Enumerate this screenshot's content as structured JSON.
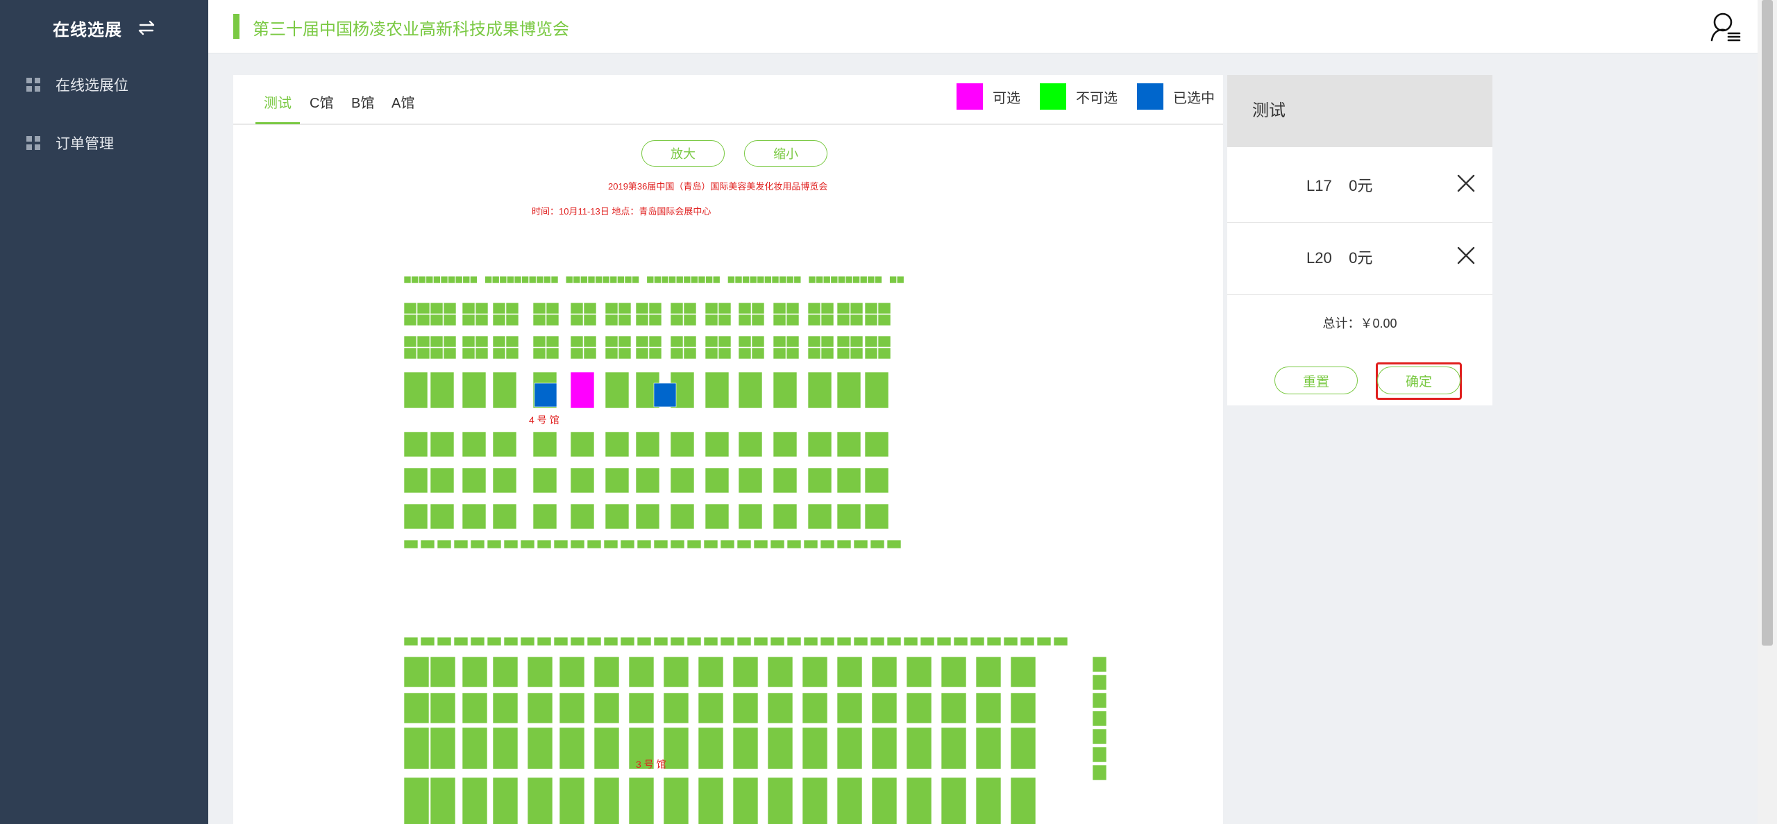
{
  "sidebar": {
    "title": "在线选展",
    "items": [
      {
        "label": "在线选展位"
      },
      {
        "label": "订单管理"
      }
    ]
  },
  "header": {
    "title": "第三十届中国杨凌农业高新科技成果博览会"
  },
  "tabs": [
    "测试",
    "C馆",
    "B馆",
    "A馆"
  ],
  "active_tab": "测试",
  "legend": [
    {
      "label": "可选",
      "color": "#ff00ff"
    },
    {
      "label": "不可选",
      "color": "#00ff00"
    },
    {
      "label": "已选中",
      "color": "#0066cc"
    }
  ],
  "zoom": {
    "in_label": "放大",
    "out_label": "缩小"
  },
  "floorplan": {
    "title": "2019第36届中国（青岛）国际美容美发化妆用品博览会",
    "subtitle": "时间：10月11-13日 地点：青岛国际会展中心",
    "hall4_label": "4 号 馆",
    "hall3_label": "3 号 馆",
    "colors": {
      "booth": "#7ac943",
      "available": "#ff00ff",
      "selected": "#0066cc",
      "hall_label": "#e0201f"
    }
  },
  "cart": {
    "title": "测试",
    "items": [
      {
        "booth": "L17",
        "price": "0元"
      },
      {
        "booth": "L20",
        "price": "0元"
      }
    ],
    "total": "总计：￥0.00",
    "reset_label": "重置",
    "confirm_label": "确定"
  }
}
